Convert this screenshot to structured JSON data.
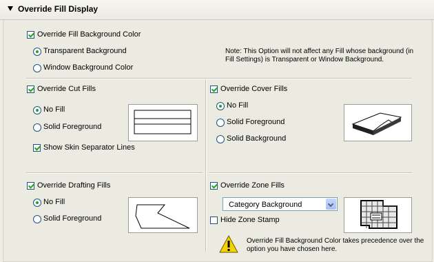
{
  "header": {
    "title": "Override Fill Display"
  },
  "background": {
    "override_label": "Override Fill Background Color",
    "override_checked": true,
    "options": [
      "Transparent Background",
      "Window Background Color"
    ],
    "selected": "Transparent Background",
    "note": "Note: This Option will not affect any Fill whose background (in Fill Settings) is Transparent or Window Background."
  },
  "cut_fills": {
    "label": "Override Cut Fills",
    "checked": true,
    "options": [
      "No Fill",
      "Solid Foreground"
    ],
    "selected": "No Fill",
    "skin_label": "Show Skin Separator Lines",
    "skin_checked": true
  },
  "cover_fills": {
    "label": "Override Cover Fills",
    "checked": true,
    "options": [
      "No Fill",
      "Solid Foreground",
      "Solid Background"
    ],
    "selected": "No Fill"
  },
  "drafting_fills": {
    "label": "Override Drafting Fills",
    "checked": true,
    "options": [
      "No Fill",
      "Solid Foreground"
    ],
    "selected": "No Fill"
  },
  "zone_fills": {
    "label": "Override Zone Fills",
    "checked": true,
    "dropdown_value": "Category Background",
    "hide_stamp_label": "Hide Zone Stamp",
    "hide_stamp_checked": false,
    "warning": "Override Fill Background Color takes precedence over the option you have chosen here."
  },
  "colors": {
    "accent": "#21a121",
    "warning": "#f5d300"
  }
}
